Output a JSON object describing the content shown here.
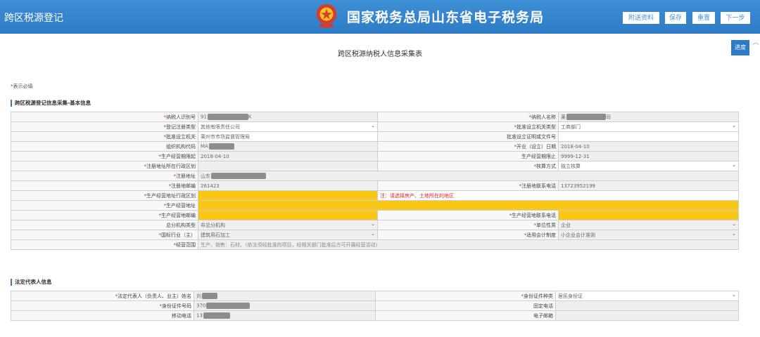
{
  "header": {
    "app_title": "跨区税源登记",
    "bureau_name": "国家税务总局山东省电子税务局",
    "buttons": {
      "attach": "附送资料",
      "save": "保存",
      "reset": "重置",
      "next": "下一步"
    }
  },
  "progress_label": "进度",
  "form_title": "跨区税源纳税人信息采集表",
  "required_note": "表示必填",
  "section1": {
    "title": "跨区税源登记信息采集-基本信息",
    "rows": [
      {
        "l1": "纳税人识别号",
        "v1": "91",
        "v1b": "K",
        "l2": "纳税人名称",
        "v2": "莱",
        "v2b": "司"
      },
      {
        "l1": "登记注册类型",
        "v1": "其他有限责任公司",
        "l2": "批准设立机关类型",
        "v2": "工商部门"
      },
      {
        "l1": "批准设立机关",
        "v1": "莱州市市场监督管理局",
        "l2": "批准设立证明或文件号",
        "v2": ""
      },
      {
        "l1": "组织机构代码",
        "v1": "MA",
        "l2": "开业（设立）日期",
        "v2": "2018-04-10"
      },
      {
        "l1": "生产经营期限起",
        "v1": "2018-04-10",
        "l2": "生产经营期限止",
        "v2": "9999-12-31"
      },
      {
        "l1": "注册地址所在行政区划",
        "v1": "",
        "l2": "核算方式",
        "v2": "独立核算"
      },
      {
        "l1": "注册地址",
        "v1": "山东"
      },
      {
        "l1": "注册地邮编",
        "v1": "261423",
        "l2": "注册地联系电话",
        "v2": "13723952199"
      },
      {
        "l1": "生产经营地址行政区划",
        "v1": "",
        "warn": "注：请选择房产、土地所在的地区"
      },
      {
        "l1": "生产经营地址",
        "v1": ""
      },
      {
        "l1": "生产经营地邮编",
        "v1": "",
        "l2": "生产经营地联系电话",
        "v2": ""
      },
      {
        "l1": "总分机构类型",
        "v1": "非总分机构",
        "l2": "单位性质",
        "v2": "企业"
      },
      {
        "l1": "国标行业（主）",
        "v1": "建筑用石加工",
        "l2": "适用会计制度",
        "v2": "小企业会计准则"
      },
      {
        "l1": "经营范围",
        "v1": "生产、销售：石材。（依法须经批准的项目，经相关部门批准后方可开展经营活动）"
      }
    ]
  },
  "section2": {
    "title": "法定代表人信息",
    "rows": [
      {
        "l1": "法定代表人（负责人、业主）姓名",
        "v1": "刘",
        "l2": "身份证件种类",
        "v2": "居民身份证"
      },
      {
        "l1": "身份证件号码",
        "v1": "370",
        "l2": "固定电话",
        "v2": ""
      },
      {
        "l1": "移动电话",
        "v1": "13",
        "l2": "电子邮箱",
        "v2": ""
      }
    ]
  },
  "colors": {
    "header_blue": "#2d7bc6",
    "required_yellow": "#f9c817",
    "required_star": "#e02020"
  },
  "icons": [
    "emblem-icon",
    "chevron-down-icon",
    "scroll-up-icon"
  ]
}
